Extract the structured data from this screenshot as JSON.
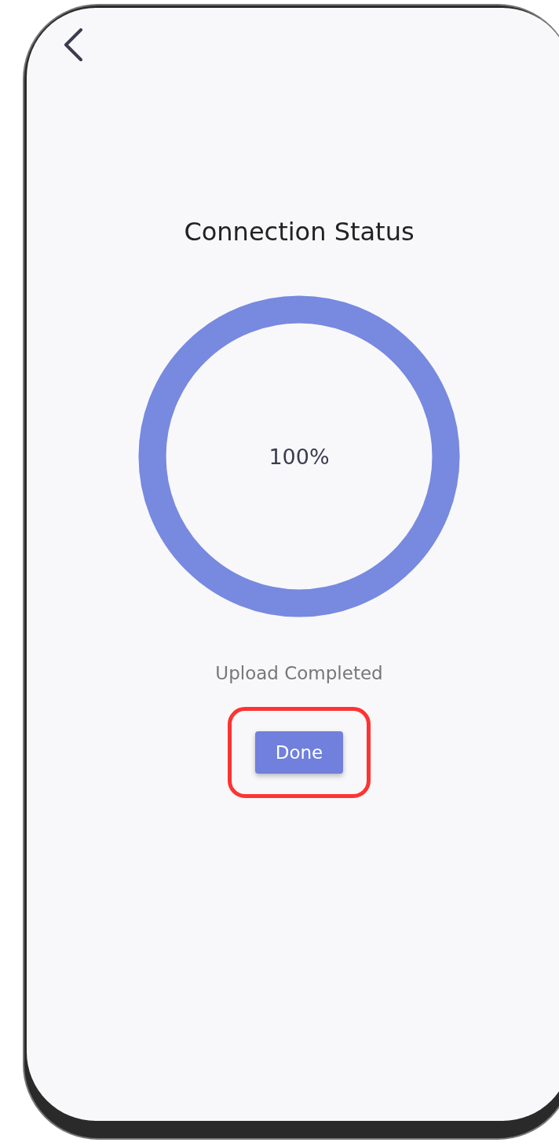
{
  "screen": {
    "title": "Connection Status"
  },
  "progress": {
    "level": 1,
    "reading": "100%"
  },
  "status_text": "Upload Completed",
  "done_button": {
    "label": "Done",
    "highlighted": true
  }
}
